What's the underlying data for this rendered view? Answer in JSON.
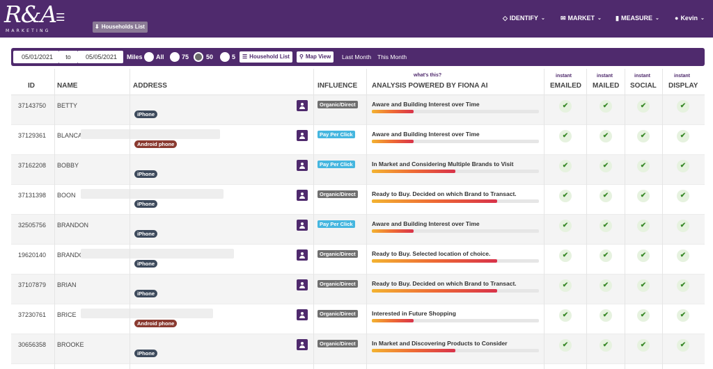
{
  "brand": {
    "logo_main": "R&A",
    "logo_sub": "MARKETING"
  },
  "header": {
    "households_chip": "Households List",
    "nav": [
      {
        "label": "IDENTIFY",
        "icon": "diamond-icon"
      },
      {
        "label": "MARKET",
        "icon": "envelope-icon"
      },
      {
        "label": "MEASURE",
        "icon": "bar-chart-icon"
      },
      {
        "label": "Kevin",
        "icon": "user-circle-icon"
      }
    ]
  },
  "filters": {
    "start_date": "05/01/2021",
    "to_label": "to",
    "end_date": "05/05/2021",
    "miles_label": "Miles",
    "radius_options": [
      "All",
      "75",
      "50",
      "5"
    ],
    "selected_radius": "50",
    "household_list_button": "Household List",
    "map_view_button": "Map View",
    "last_month": "Last Month",
    "this_month": "This Month"
  },
  "table": {
    "columns": {
      "id": "ID",
      "name": "NAME",
      "address": "ADDRESS",
      "influence": "INFLUENCE",
      "analysis": "ANALYSIS POWERED BY FIONA AI",
      "emailed": "EMAILED",
      "mailed": "MAILED",
      "social": "SOCIAL",
      "display": "DISPLAY"
    },
    "instant_label": "instant",
    "whats_this": "what's this?",
    "rows": [
      {
        "id": "37143750",
        "name": "BETTY",
        "device": "iPhone",
        "device_type": "iphone",
        "influence": "Organic/Direct",
        "influence_type": "organic",
        "analysis": "Aware and Building Interest over Time",
        "progress": 0.25
      },
      {
        "id": "37129361",
        "name": "BLANCA",
        "device": "Android phone",
        "device_type": "android",
        "influence": "Pay Per Click",
        "influence_type": "ppc",
        "analysis": "Aware and Building Interest over Time",
        "progress": 0.25
      },
      {
        "id": "37162208",
        "name": "BOBBY",
        "device": "iPhone",
        "device_type": "iphone",
        "influence": "Pay Per Click",
        "influence_type": "ppc",
        "analysis": "In Market and Considering Multiple Brands to Visit",
        "progress": 0.5
      },
      {
        "id": "37131398",
        "name": "BOON",
        "device": "iPhone",
        "device_type": "iphone",
        "influence": "Organic/Direct",
        "influence_type": "organic",
        "analysis": "Ready to Buy. Decided on which Brand to Transact.",
        "progress": 0.75
      },
      {
        "id": "32505756",
        "name": "BRANDON",
        "device": "iPhone",
        "device_type": "iphone",
        "influence": "Pay Per Click",
        "influence_type": "ppc",
        "analysis": "Aware and Building Interest over Time",
        "progress": 0.25
      },
      {
        "id": "19620140",
        "name": "BRANDON",
        "device": "iPhone",
        "device_type": "iphone",
        "influence": "Organic/Direct",
        "influence_type": "organic",
        "analysis": "Ready to Buy. Selected location of choice.",
        "progress": 0.75
      },
      {
        "id": "37107879",
        "name": "BRIAN",
        "device": "iPhone",
        "device_type": "iphone",
        "influence": "Organic/Direct",
        "influence_type": "organic",
        "analysis": "Ready to Buy. Decided on which Brand to Transact.",
        "progress": 0.75
      },
      {
        "id": "37230761",
        "name": "BRICE",
        "device": "Android phone",
        "device_type": "android",
        "influence": "Organic/Direct",
        "influence_type": "organic",
        "analysis": "Interested in Future Shopping",
        "progress": 0.25
      },
      {
        "id": "30656358",
        "name": "BROOKE",
        "device": "iPhone",
        "device_type": "iphone",
        "influence": "Organic/Direct",
        "influence_type": "organic",
        "analysis": "In Market and Discovering Products to Consider",
        "progress": 0.5
      }
    ]
  },
  "colors": {
    "brand": "#4f2a6d",
    "ppc": "#45b6df",
    "organic": "#6f6f6f",
    "iphone": "#3d4a5c",
    "android": "#8a3a30",
    "check": "#3b8a2a"
  }
}
